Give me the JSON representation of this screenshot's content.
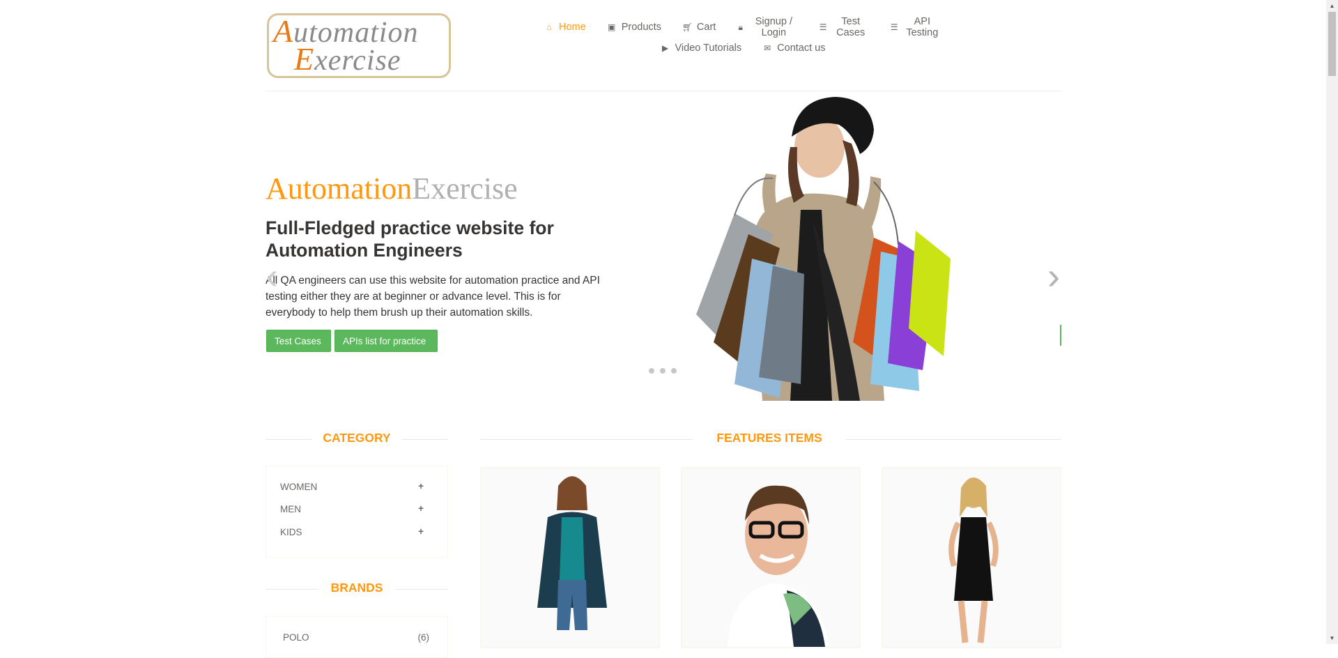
{
  "logo": {
    "line1": "Automation",
    "line2": "Exercise"
  },
  "nav": {
    "home": "Home",
    "products": "Products",
    "cart": "Cart",
    "signup_login": "Signup / Login",
    "test_cases": "Test Cases",
    "api_testing": "API Testing",
    "video_tutorials": "Video Tutorials",
    "contact_us": "Contact us"
  },
  "icons": {
    "home": "home-icon",
    "products": "products-icon",
    "cart": "cart-icon",
    "signup": "lock-icon",
    "test_cases": "list-icon",
    "api_testing": "list-icon",
    "video": "video-icon",
    "contact": "envelope-icon"
  },
  "colors": {
    "accent": "#fe980f",
    "button": "#5cb85c",
    "text": "#696763",
    "heading": "#363432"
  },
  "slider": {
    "brand_part1": "Automation",
    "brand_part2": "Exercise",
    "heading": "Full-Fledged practice website for Automation Engineers",
    "description": "All QA engineers can use this website for automation practice and API testing either they are at beginner or advance level. This is for everybody to help them brush up their automation skills.",
    "btn_test_cases": "Test Cases",
    "btn_apis": "APIs list for practice",
    "prev": "‹",
    "next": "›"
  },
  "sidebar": {
    "category_title": "CATEGORY",
    "categories": [
      {
        "label": "WOMEN",
        "toggle": "+"
      },
      {
        "label": "MEN",
        "toggle": "+"
      },
      {
        "label": "KIDS",
        "toggle": "+"
      }
    ],
    "brands_title": "BRANDS",
    "brands": [
      {
        "label": "POLO",
        "count": "(6)"
      }
    ]
  },
  "features": {
    "title": "FEATURES ITEMS"
  }
}
